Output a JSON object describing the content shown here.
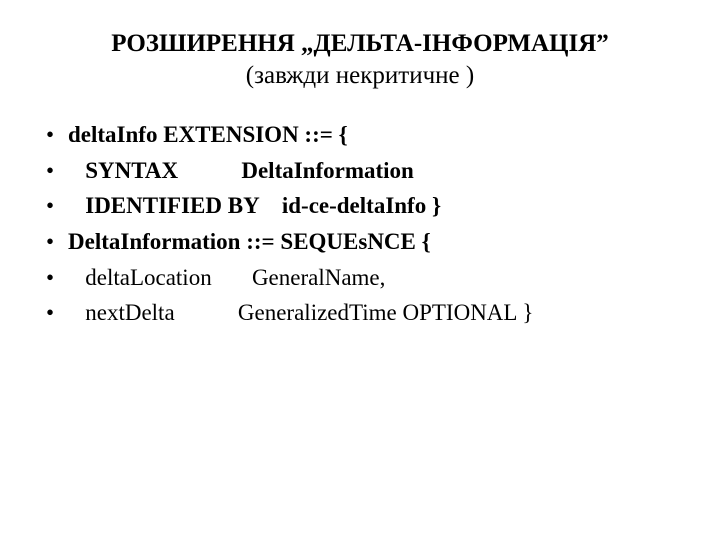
{
  "title": {
    "main": "РОЗШИРЕННЯ „ДЕЛЬТА-ІНФОРМАЦІЯ”",
    "sub": "(завжди некритичне )"
  },
  "lines": [
    {
      "text": "deltaInfo EXTENSION ::= {",
      "bold": true
    },
    {
      "text": "   SYNTAX           DeltaInformation",
      "bold": true
    },
    {
      "text": "   IDENTIFIED BY    id-ce-deltaInfo }",
      "bold": true
    },
    {
      "text": "DeltaInformation ::= SEQUEsNCE {",
      "bold": true
    },
    {
      "text": "   deltaLocation       GeneralName,",
      "bold": false
    },
    {
      "text": "   nextDelta           GeneralizedTime OPTIONAL }",
      "bold": false
    }
  ]
}
